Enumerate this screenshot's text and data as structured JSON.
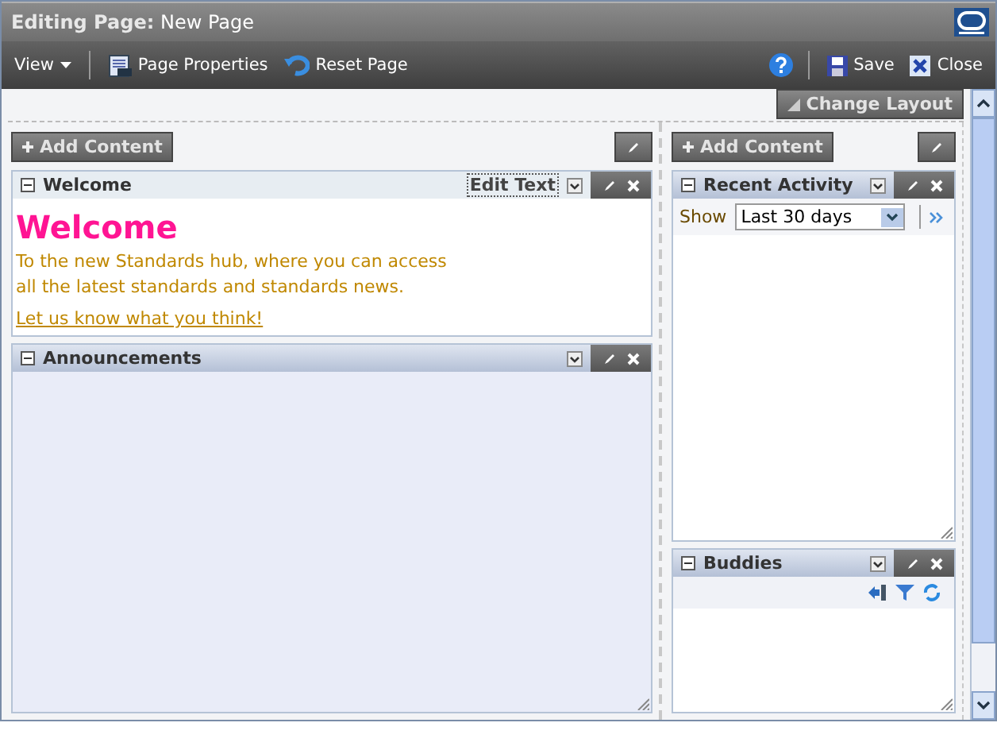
{
  "window": {
    "title_label": "Editing Page:",
    "title": "New Page"
  },
  "toolbar": {
    "left": [
      {
        "label": "View",
        "kind": "menu"
      },
      {
        "label": "Page Properties",
        "kind": "properties"
      },
      {
        "label": "Reset Page",
        "kind": "reset"
      }
    ],
    "right": [
      {
        "label": "Save",
        "kind": "save"
      },
      {
        "label": "Close",
        "kind": "close"
      }
    ]
  },
  "change_layout": "Change Layout",
  "columns": [
    {
      "add_content": "Add Content",
      "portlets": [
        {
          "kind": "text",
          "title": "Welcome",
          "highlighted": true,
          "edit_text": "Edit Text",
          "heading": "Welcome",
          "body": [
            "To the new Standards hub, where you can access",
            "all the latest standards and standards news."
          ],
          "link": "Let us know what you think!"
        },
        {
          "kind": "empty",
          "title": "Announcements",
          "highlighted": false
        }
      ]
    },
    {
      "add_content": "Add Content",
      "portlets": [
        {
          "kind": "activity",
          "title": "Recent Activity",
          "highlighted": false,
          "show_label": "Show",
          "filter": "Last 30 days"
        },
        {
          "kind": "buddies",
          "title": "Buddies",
          "highlighted": false
        }
      ]
    }
  ]
}
